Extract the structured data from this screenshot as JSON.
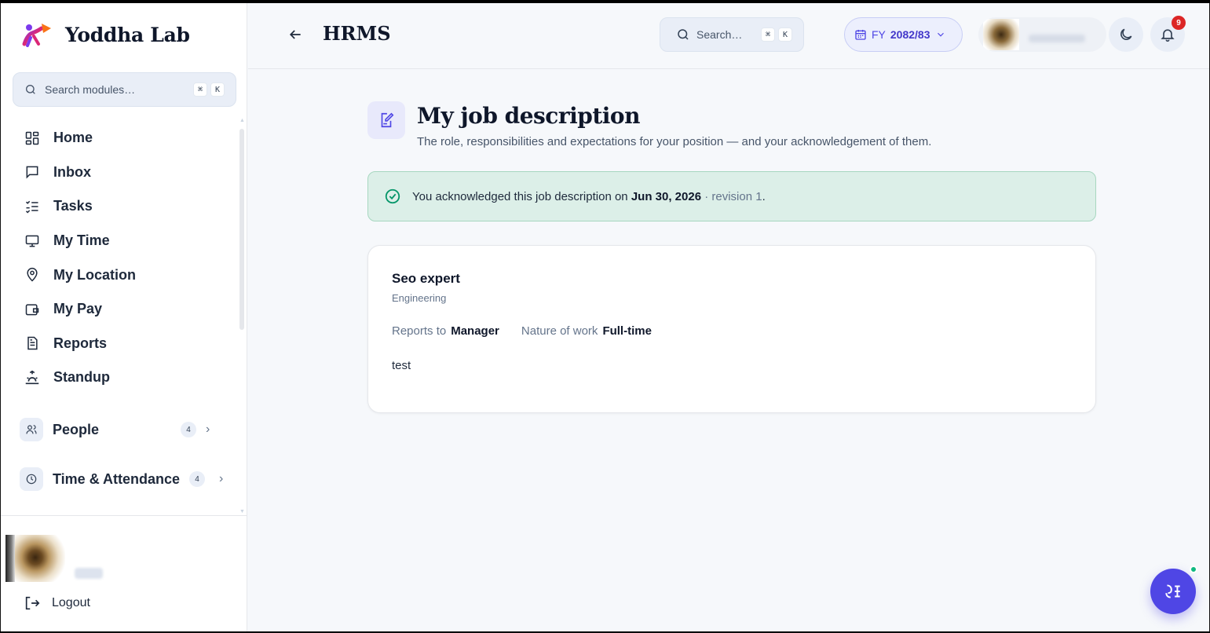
{
  "brand": {
    "name": "Yoddha Lab"
  },
  "sidebar": {
    "search": {
      "placeholder": "Search modules…",
      "shortcut": [
        "⌘",
        "K"
      ]
    },
    "items": [
      {
        "label": "Home",
        "icon": "grid-icon"
      },
      {
        "label": "Inbox",
        "icon": "message-square-icon"
      },
      {
        "label": "Tasks",
        "icon": "checklist-icon"
      },
      {
        "label": "My Time",
        "icon": "monitor-icon"
      },
      {
        "label": "My Location",
        "icon": "map-pin-icon"
      },
      {
        "label": "My Pay",
        "icon": "wallet-icon"
      },
      {
        "label": "Reports",
        "icon": "file-text-icon"
      },
      {
        "label": "Standup",
        "icon": "sunrise-icon"
      }
    ],
    "groups": [
      {
        "label": "People",
        "count": "4",
        "icon": "users-icon"
      },
      {
        "label": "Time & Attendance",
        "count": "4",
        "icon": "clock-icon"
      }
    ],
    "logout_label": "Logout"
  },
  "topbar": {
    "title": "HRMS",
    "search": {
      "placeholder": "Search…",
      "shortcut": [
        "⌘",
        "K"
      ]
    },
    "fiscal_year": {
      "prefix": "FY",
      "value": "2082/83"
    },
    "notifications_count": "9"
  },
  "page": {
    "title": "My job description",
    "subtitle": "The role, responsibilities and expectations for your position — and your acknowledgement of them.",
    "acknowledgement": {
      "prefix": "You acknowledged this job description on ",
      "date": "Jun 30, 2026",
      "separator": " · ",
      "revision": "revision 1",
      "suffix": "."
    },
    "job": {
      "title": "Seo expert",
      "department": "Engineering",
      "reports_to_label": "Reports to",
      "reports_to_value": "Manager",
      "nature_label": "Nature of work",
      "nature_value": "Full-time",
      "description": "test"
    }
  },
  "colors": {
    "accent": "#4f46e5",
    "success_bg": "#dcefe8",
    "success_icon": "#059669",
    "notification": "#dc2626"
  }
}
